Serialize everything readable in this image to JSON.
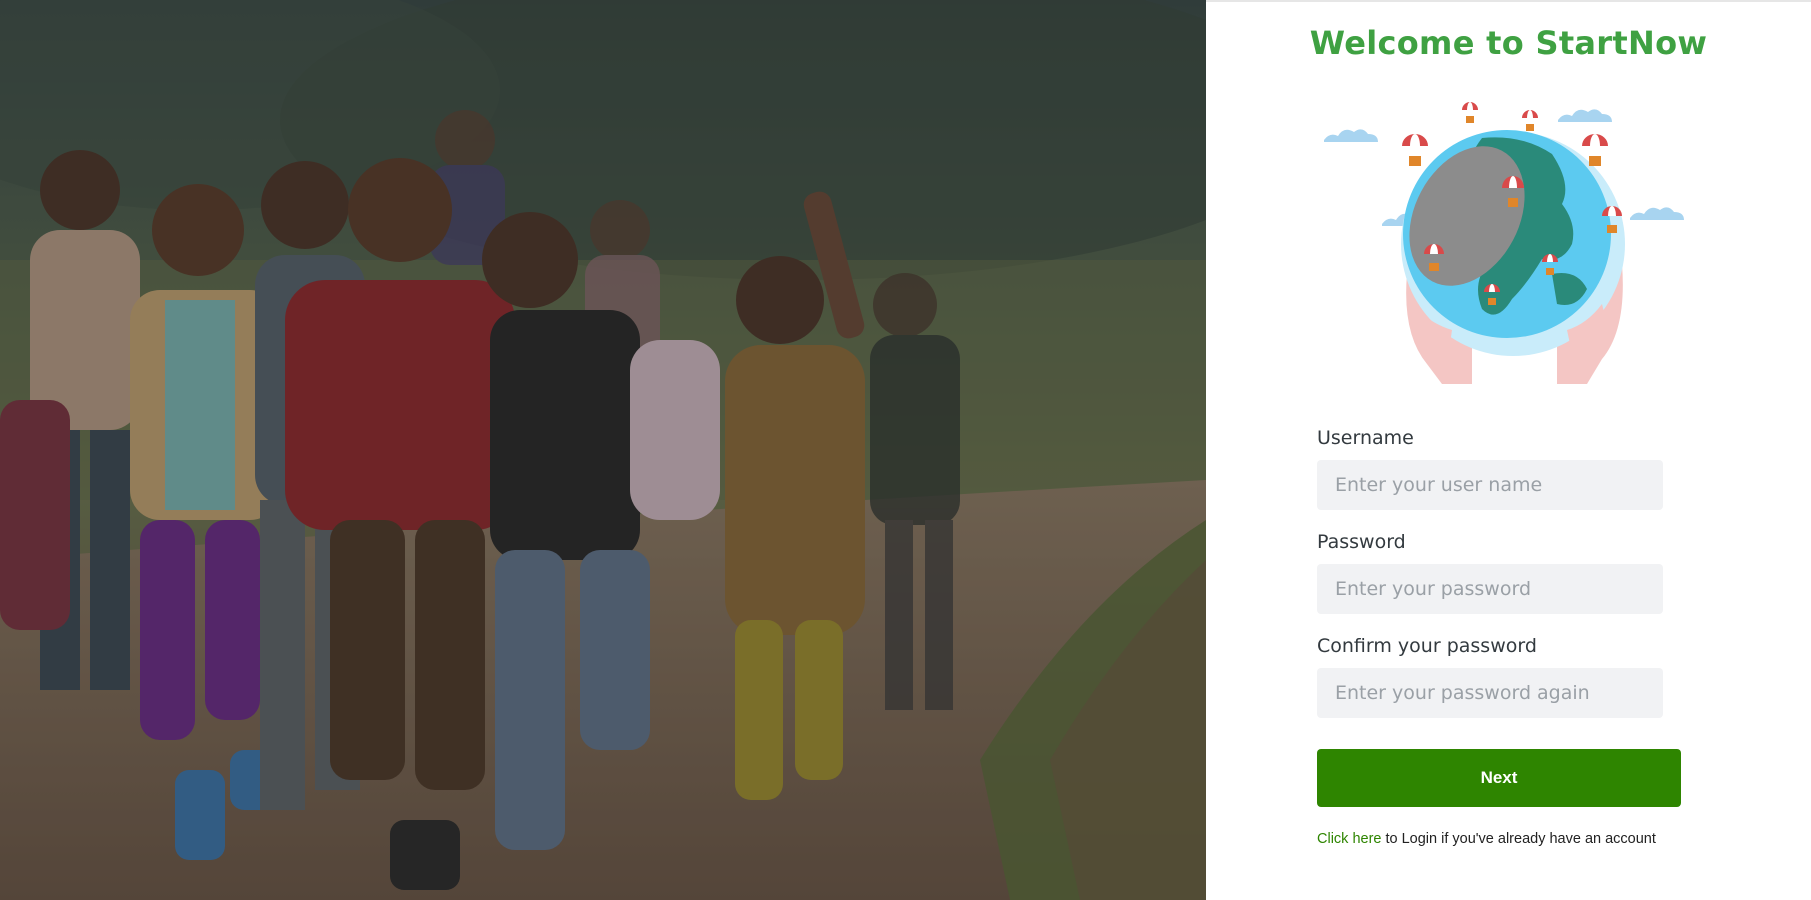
{
  "hero": {
    "image_alt_icon": "children-running-photo"
  },
  "panel": {
    "title": "Welcome to StartNow",
    "illustration_icon": "globe-hands-parachutes-illustration"
  },
  "form": {
    "username": {
      "label": "Username",
      "placeholder": "Enter your user name",
      "value": ""
    },
    "password": {
      "label": "Password",
      "placeholder": "Enter your password",
      "value": ""
    },
    "confirm_password": {
      "label": "Confirm your password",
      "placeholder": "Enter your password again",
      "value": ""
    },
    "next_label": "Next",
    "login_link_label": "Click here",
    "login_suffix": " to Login if you've already have an account"
  },
  "colors": {
    "brand_green": "#3fa142",
    "button_green": "#2e8500",
    "input_bg": "#f1f2f4"
  }
}
